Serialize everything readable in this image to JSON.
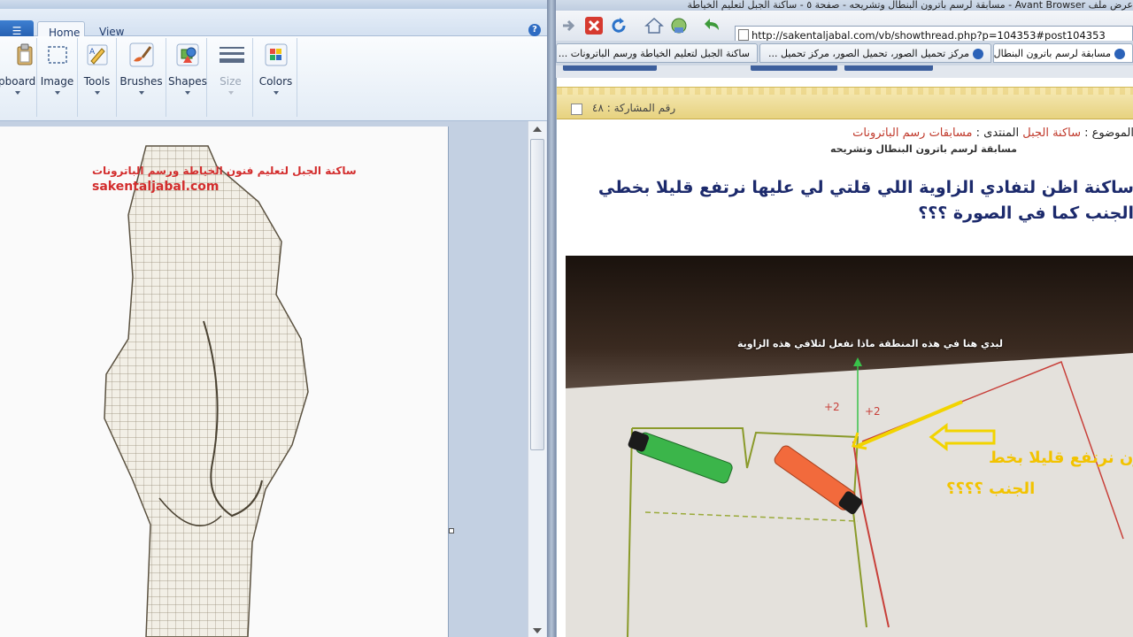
{
  "paint": {
    "menu_button": "☰",
    "tabs": [
      "Home",
      "View"
    ],
    "help_symbol": "?",
    "ribbon_groups": [
      {
        "label": "pboard",
        "icon": "clipboard-icon"
      },
      {
        "label": "Image",
        "icon": "select-icon"
      },
      {
        "label": "Tools",
        "icon": "pencil-icon"
      },
      {
        "label": "Brushes",
        "icon": "brush-icon"
      },
      {
        "label": "Shapes",
        "icon": "shapes-icon"
      },
      {
        "label": "Size",
        "icon": "size-lines-icon"
      },
      {
        "label": "Colors",
        "icon": "palette-icon"
      }
    ],
    "canvas_watermark": {
      "line1": "ساكنة الجبل لتعليم فنون الخياطة ورسم الباترونات",
      "line2": "sakentaljabal.com"
    }
  },
  "browser": {
    "title": "عرض  ملف   Avant Browser  -  مسابقة لرسم باترون البنطال وتشريحه - صفحة ٥ - ساكنة الجبل لتعليم الخياطة",
    "url": "http://sakentaljabal.com/vb/showthread.php?p=104353#post104353",
    "tabs": [
      {
        "label": "مسابقة لرسم باترون البنطال وتشريحه"
      },
      {
        "label": "مركز تحميل الصور، تحميل الصور، مركز تحميل ..."
      },
      {
        "label": "ساكنة الجبل لتعليم الخياطة ورسم الباترونات ..."
      }
    ],
    "post_number": "رقم المشاركة : ٤٨",
    "breadcrumb": {
      "prefix": "الموضوع : ",
      "site": "ساكنة الجبل",
      "forum_label": " المنتدى : ",
      "forum": "مسابقات رسم الباترونات"
    },
    "breadcrumb_sub": "مسابقة لرسم باترون البنطال وتشريحه",
    "post_text": "ساكنة اظن لتفادي الزاوية اللي قلتي لي عليها نرتفع قليلا بخطي الجنب كما في الصورة ؟؟؟",
    "photo": {
      "note": "لبدي هنا في هذه المنطقة ماذا نفعل لتلافي هذه الزاوية",
      "yellow_line1": "ون نرتفع قليلا بخط",
      "yellow_line2": "الجنب ؟؟؟؟",
      "mark1": "+2",
      "mark2": "+2"
    }
  }
}
